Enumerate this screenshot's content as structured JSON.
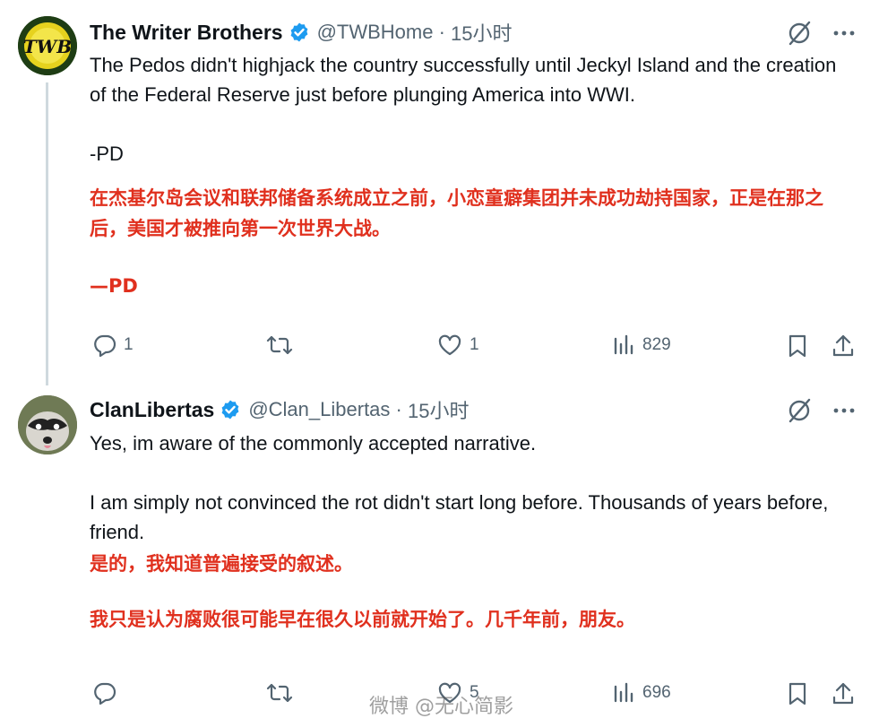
{
  "tweets": [
    {
      "name": "The Writer Brothers",
      "handle": "@TWBHome",
      "sep": " · ",
      "time": "15小时",
      "avatar_text": "TWB",
      "body_en": [
        "The Pedos didn't highjack the country successfully until Jeckyl Island and the creation of the Federal Reserve just before plunging America into WWI.",
        "-PD"
      ],
      "body_zh": [
        "在杰基尔岛会议和联邦储备系统成立之前，小恋童癖集团并未成功劫持国家，正是在那之后，美国才被推向第一次世界大战。",
        "—PD"
      ],
      "replies": "1",
      "reposts": "",
      "likes": "1",
      "views": "829"
    },
    {
      "name": "ClanLibertas",
      "handle": "@Clan_Libertas",
      "sep": " · ",
      "time": "15小时",
      "body_en": [
        "Yes, im aware of the commonly accepted narrative.",
        "I am simply not convinced the rot didn't start long before. Thousands of years before, friend."
      ],
      "body_zh": [
        "是的，我知道普遍接受的叙述。",
        "我只是认为腐败很可能早在很久以前就开始了。几千年前，朋友。"
      ],
      "replies": "",
      "reposts": "",
      "likes": "5",
      "views": "696"
    }
  ],
  "watermark": "微博 @无心简影",
  "colors": {
    "verified": "#1d9bf0",
    "muted": "#536471",
    "accent_text": "#e0301e",
    "thread_line": "#cfd9de"
  }
}
